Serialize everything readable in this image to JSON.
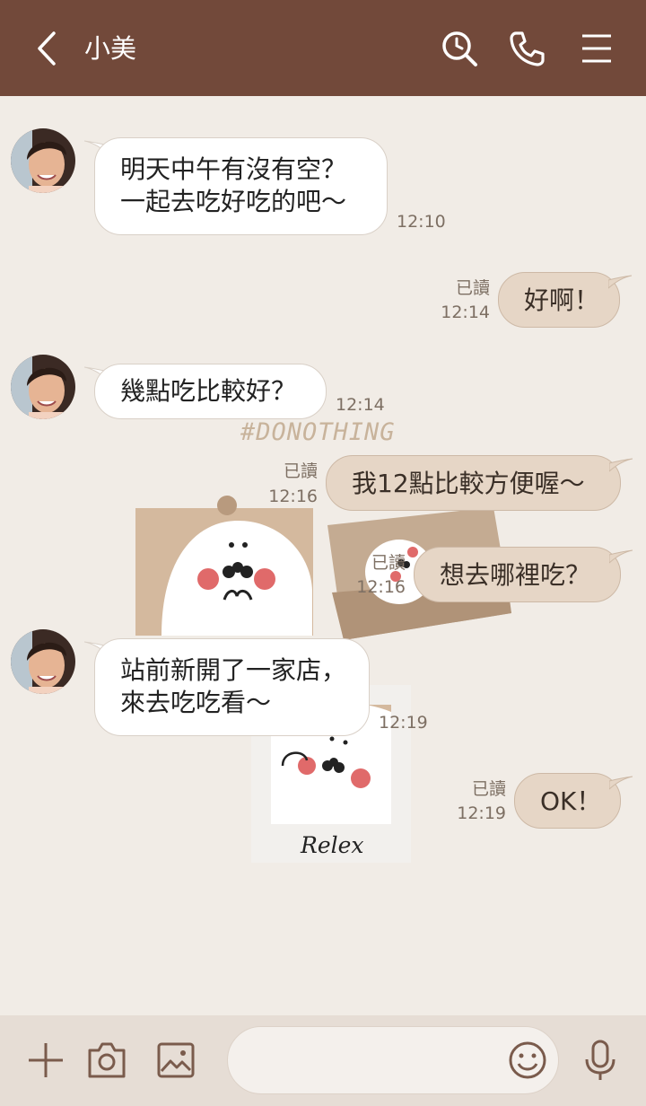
{
  "header": {
    "back_icon": "chevron-left-icon",
    "contact_name": "小美",
    "icons": [
      "search-icon",
      "phone-icon",
      "menu-icon"
    ]
  },
  "decoration": {
    "hashtag": "#DONOTHING",
    "relax_label": "Relex"
  },
  "messages": [
    {
      "direction": "in",
      "text": "明天中午有沒有空？\n一起去吃好吃的吧〜",
      "time": "12:10"
    },
    {
      "direction": "out",
      "text": "好啊！",
      "read": "已讀",
      "time": "12:14"
    },
    {
      "direction": "in",
      "text": "幾點吃比較好？",
      "time": "12:14"
    },
    {
      "direction": "out",
      "text": "我12點比較方便喔〜",
      "read": "已讀",
      "time": "12:16"
    },
    {
      "direction": "out",
      "text": "想去哪裡吃？",
      "read": "已讀",
      "time": "12:16"
    },
    {
      "direction": "in",
      "text": "站前新開了一家店，\n來去吃吃看〜",
      "time": "12:19"
    },
    {
      "direction": "out",
      "text": "OK！",
      "read": "已讀",
      "time": "12:19"
    }
  ],
  "input_bar": {
    "icons": [
      "plus-icon",
      "camera-icon",
      "image-icon",
      "emoji-icon",
      "microphone-icon"
    ],
    "placeholder": ""
  },
  "colors": {
    "header": "#72493a",
    "background": "#f1ece6",
    "outgoing_bubble": "#e6d6c6",
    "incoming_bubble": "#ffffff",
    "input_bar": "#e6ddd5"
  }
}
